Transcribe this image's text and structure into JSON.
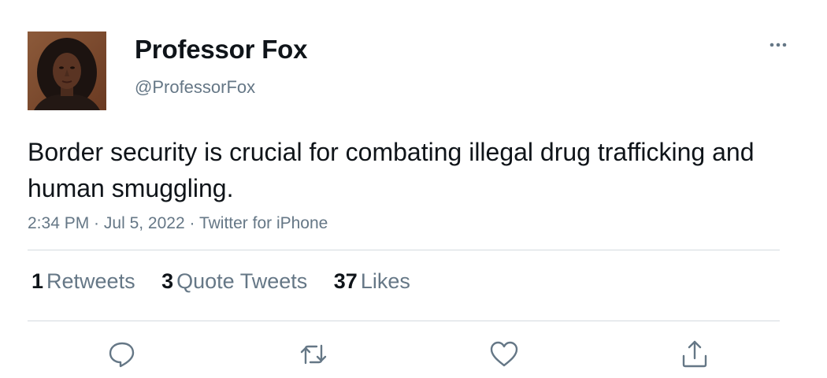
{
  "author": {
    "display_name": "Professor Fox",
    "handle": "@ProfessorFox",
    "avatar_icon": "profile-photo"
  },
  "tweet": {
    "text": "Border security is crucial for combating illegal drug trafficking and human smuggling.",
    "time": "2:34 PM",
    "separator": " · ",
    "date": "Jul 5, 2022",
    "source": "Twitter for iPhone"
  },
  "stats": {
    "retweets_count": "1",
    "retweets_label": "Retweets",
    "quotes_count": "3",
    "quotes_label": "Quote Tweets",
    "likes_count": "37",
    "likes_label": "Likes"
  },
  "actions": {
    "reply_icon": "reply-icon",
    "retweet_icon": "retweet-icon",
    "like_icon": "heart-icon",
    "share_icon": "share-icon",
    "more_icon": "more-icon"
  },
  "colors": {
    "text_primary": "#0f1419",
    "text_secondary": "#657786",
    "divider": "#d4dadf",
    "background": "#ffffff"
  }
}
